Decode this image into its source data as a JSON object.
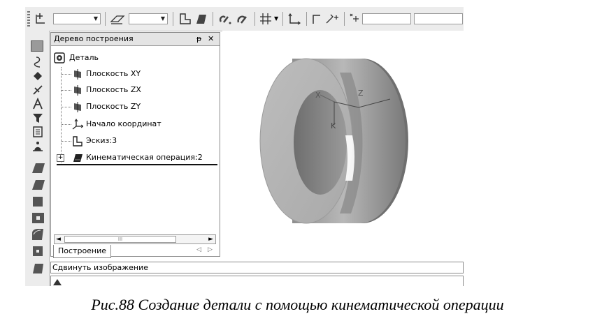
{
  "tree_panel": {
    "title": "Дерево построения",
    "pin_symbol": "ᵽ",
    "close_symbol": "✕",
    "items": [
      {
        "label": "Деталь",
        "icon": "part-icon"
      },
      {
        "label": "Плоскость XY",
        "icon": "plane-icon"
      },
      {
        "label": "Плоскость ZX",
        "icon": "plane-icon"
      },
      {
        "label": "Плоскость ZY",
        "icon": "plane-icon"
      },
      {
        "label": "Начало координат",
        "icon": "origin-icon"
      },
      {
        "label": "Эскиз:3",
        "icon": "sketch-icon"
      },
      {
        "label": "Кинематическая операция:2",
        "icon": "kinematic-operation-icon",
        "expander": "+"
      }
    ],
    "scroll_thumb_text": "III",
    "scroll_left": "◄",
    "scroll_right": "►",
    "tab_label": "Построение",
    "tab_nav_prev": "◁",
    "tab_nav_next": "▷"
  },
  "viewport": {
    "axis_labels": [
      "X",
      "Z",
      "K"
    ]
  },
  "status_bar": {
    "text": "Сдвинуть изображение"
  },
  "caption": "Рис.88 Создание детали с помощью кинематической операции"
}
